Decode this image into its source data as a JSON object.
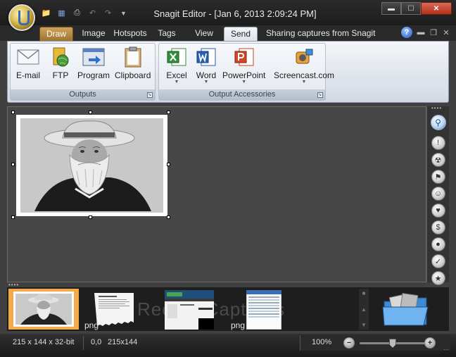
{
  "window": {
    "title": "Snagit Editor - [Jan 6, 2013 2:09:24 PM]",
    "min_glyph": "▬",
    "max_glyph": "☐",
    "close_glyph": "✕"
  },
  "quick_access": {
    "customize_glyph": "▼"
  },
  "tabs": {
    "draw": "Draw",
    "image": "Image",
    "hotspots": "Hotspots",
    "tags": "Tags",
    "view": "View",
    "send": "Send",
    "profile": "Sharing captures from Snagit",
    "help": "?"
  },
  "ribbon": {
    "outputs_group": "Outputs",
    "accessories_group": "Output Accessories",
    "outputs": [
      {
        "label": "E-mail",
        "icon": "envelope-icon"
      },
      {
        "label": "FTP",
        "icon": "ftp-globe-icon"
      },
      {
        "label": "Program",
        "icon": "program-window-icon"
      },
      {
        "label": "Clipboard",
        "icon": "clipboard-icon"
      }
    ],
    "accessories": [
      {
        "label": "Excel",
        "icon": "excel-icon"
      },
      {
        "label": "Word",
        "icon": "word-icon"
      },
      {
        "label": "PowerPoint",
        "icon": "powerpoint-icon"
      },
      {
        "label": "Screencast.com",
        "icon": "screencast-icon"
      }
    ]
  },
  "tray": {
    "watermark": "Recent Captures",
    "thumbs": [
      {
        "type": "photo",
        "label": ""
      },
      {
        "type": "document",
        "label": "png"
      },
      {
        "type": "website",
        "label": ""
      },
      {
        "type": "screenshot",
        "label": "png"
      }
    ]
  },
  "status": {
    "image_info": "215 x 144 x 32-bit",
    "cursor_pos": "0,0",
    "selection_size": "215x144",
    "zoom": "100%",
    "zoom_level": 0.5
  },
  "colors": {
    "accent_orange": "#f4a94a",
    "send_tab": "#f4f6f9",
    "close_red": "#c43a24"
  }
}
